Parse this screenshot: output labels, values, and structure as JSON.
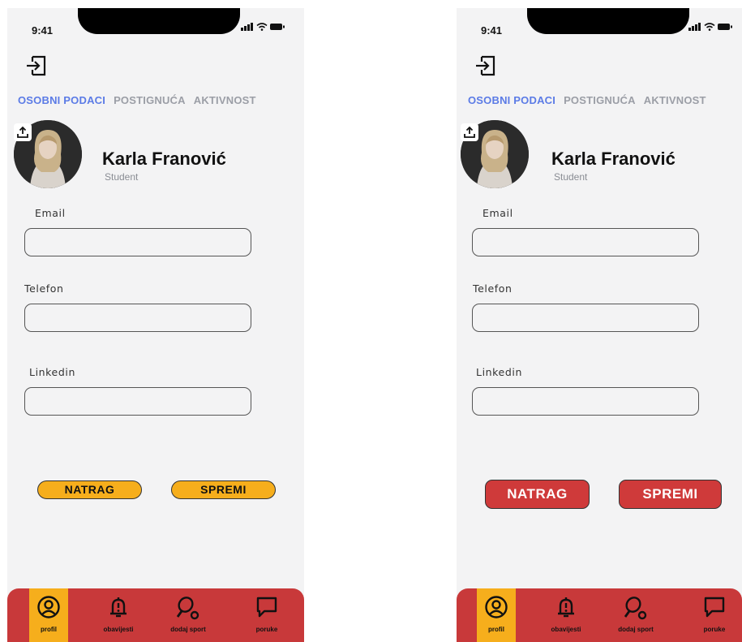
{
  "status": {
    "time": "9:41"
  },
  "tabs": [
    "OSOBNI PODACI",
    "POSTIGNUĆA",
    "AKTIVNOST"
  ],
  "profile": {
    "name": "Karla Franović",
    "role": "Student"
  },
  "form": {
    "email_label": "Email",
    "phone_label": "Telefon",
    "linkedin_label": "Linkedin"
  },
  "buttons": {
    "back": "NATRAG",
    "save": "SPREMI"
  },
  "nav": [
    {
      "label": "profil",
      "icon": "user-circle-icon"
    },
    {
      "label": "obavijesti",
      "icon": "bell-alert-icon"
    },
    {
      "label": "dodaj sport",
      "icon": "racket-icon"
    },
    {
      "label": "poruke",
      "icon": "message-icon"
    }
  ],
  "colors": {
    "accent_tab": "#5b7be6",
    "navbar": "#c8393a",
    "active_nav": "#f6ae1c",
    "button_yellow": "#f6ae1c",
    "button_red": "#cf3a3a"
  }
}
